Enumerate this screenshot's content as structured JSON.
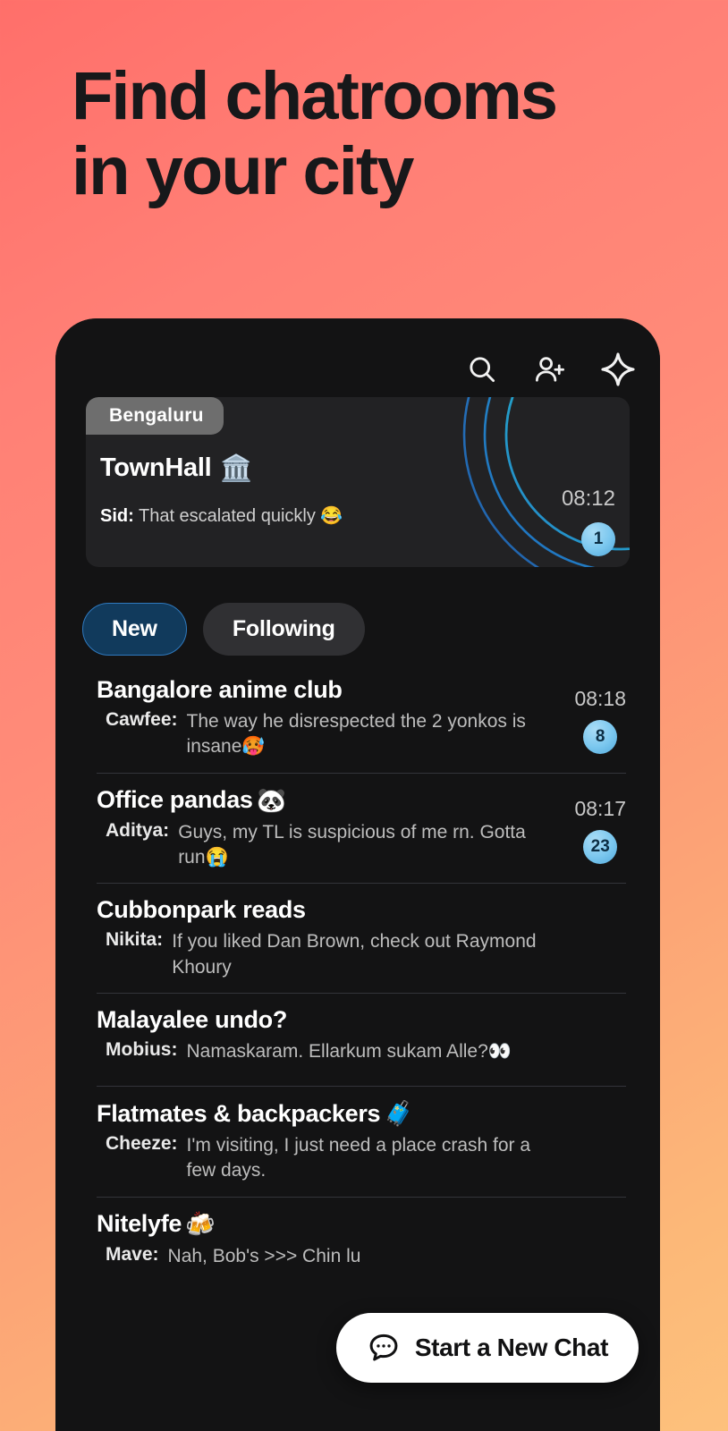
{
  "hero": {
    "line1": "Find chatrooms",
    "line2": "in your city",
    "text_color": "#17181A"
  },
  "background": {
    "gradient_start": "#FF6F6A",
    "gradient_end": "#FDC17C"
  },
  "phone": {
    "screen_bg": "#131314",
    "topbar": {
      "icons": [
        {
          "name": "search-icon",
          "label": "Search"
        },
        {
          "name": "add-person-icon",
          "label": "Add person"
        },
        {
          "name": "sparkle-icon",
          "label": "Sparkle"
        }
      ]
    },
    "featured_card": {
      "city_pill": "Bengaluru",
      "title": "TownHall",
      "title_emoji": "🏛️",
      "sender": "Sid:",
      "message": "That escalated quickly 😂",
      "time": "08:12",
      "unread": "1",
      "accent_colors": [
        "#2F7FD0",
        "#2AA9CF",
        "#25C6C6"
      ]
    },
    "tabs": [
      {
        "label": "New",
        "active": true
      },
      {
        "label": "Following",
        "active": false
      }
    ],
    "chats": [
      {
        "title": "Bangalore anime club",
        "title_emoji": "",
        "sender": "Cawfee:",
        "message": "The way he disrespected the 2 yonkos is insane🥵",
        "time": "08:18",
        "unread": "8"
      },
      {
        "title": "Office pandas",
        "title_emoji": "🐼",
        "sender": "Aditya:",
        "message": "Guys, my TL is suspicious of me rn. Gotta run😭",
        "time": "08:17",
        "unread": "23"
      },
      {
        "title": "Cubbonpark reads",
        "title_emoji": "",
        "sender": "Nikita:",
        "message": "If you liked Dan Brown, check out Raymond Khoury",
        "time": "",
        "unread": ""
      },
      {
        "title": "Malayalee undo?",
        "title_emoji": "",
        "sender": "Mobius:",
        "message": "Namaskaram. Ellarkum sukam Alle?👀",
        "time": "",
        "unread": ""
      },
      {
        "title": "Flatmates & backpackers",
        "title_emoji": "🧳",
        "sender": "Cheeze:",
        "message": "I'm visiting, I just need a place crash for a few days.",
        "time": "",
        "unread": ""
      },
      {
        "title": "Nitelyfe",
        "title_emoji": "🍻",
        "sender": "Mave:",
        "message": "Nah, Bob's >>> Chin lu",
        "time": "",
        "unread": ""
      }
    ],
    "cta": {
      "label": "Start a New Chat",
      "icon": "chat-bubble-dots-icon",
      "bg": "#FFFFFF"
    }
  }
}
